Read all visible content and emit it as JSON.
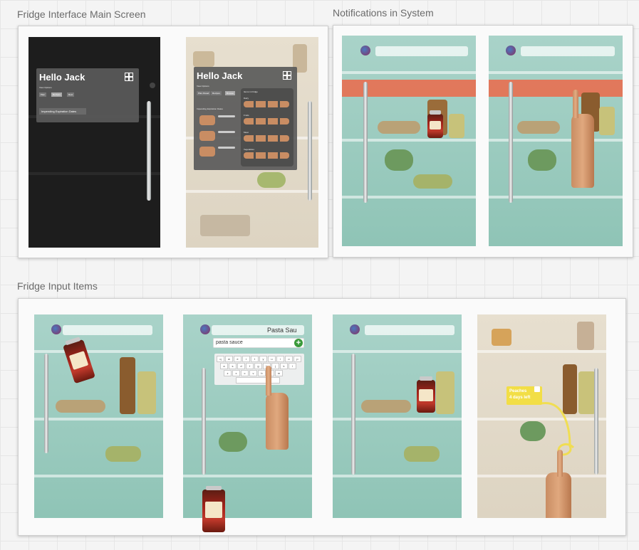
{
  "sections": {
    "main_screen_title": "Fridge Interface Main Screen",
    "notifications_title": "Notifications in System",
    "input_items_title": "Fridge Input Items"
  },
  "hello_dark": {
    "title": "Hello Jack",
    "subtitle": "View Options",
    "chips": [
      "Plan",
      "Recipes",
      "Rest"
    ],
    "dropdown": "Impending Expiration Dates"
  },
  "hello_light": {
    "title": "Hello Jack",
    "subtitle": "View Options",
    "chips": [
      "Plan Ahead",
      "Recipes",
      "Browse"
    ],
    "left_header": "Impending Expiration Dates",
    "items_header": "Items in Fridge",
    "categories": [
      "Dairy",
      "Fruits",
      "Meat",
      "Vegetables"
    ]
  },
  "input_screen": {
    "heading": "Pasta Sau",
    "search_value": "pasta sauce",
    "keyboard_rows": [
      [
        "q",
        "w",
        "e",
        "r",
        "t",
        "y",
        "u",
        "i",
        "o",
        "p"
      ],
      [
        "a",
        "s",
        "d",
        "f",
        "g",
        "h",
        "j",
        "k",
        "l"
      ],
      [
        "z",
        "x",
        "c",
        "v",
        "b",
        "n",
        "m"
      ]
    ]
  },
  "reminder_card": {
    "line1": "Peaches",
    "line2": "4 days left"
  },
  "colors": {
    "teal_overlay": "#8fc4b6",
    "alert": "#e86e50",
    "panel": "#5a5a5a",
    "confirm_green": "#3a9a3a",
    "reminder_yellow": "#f2de46"
  }
}
